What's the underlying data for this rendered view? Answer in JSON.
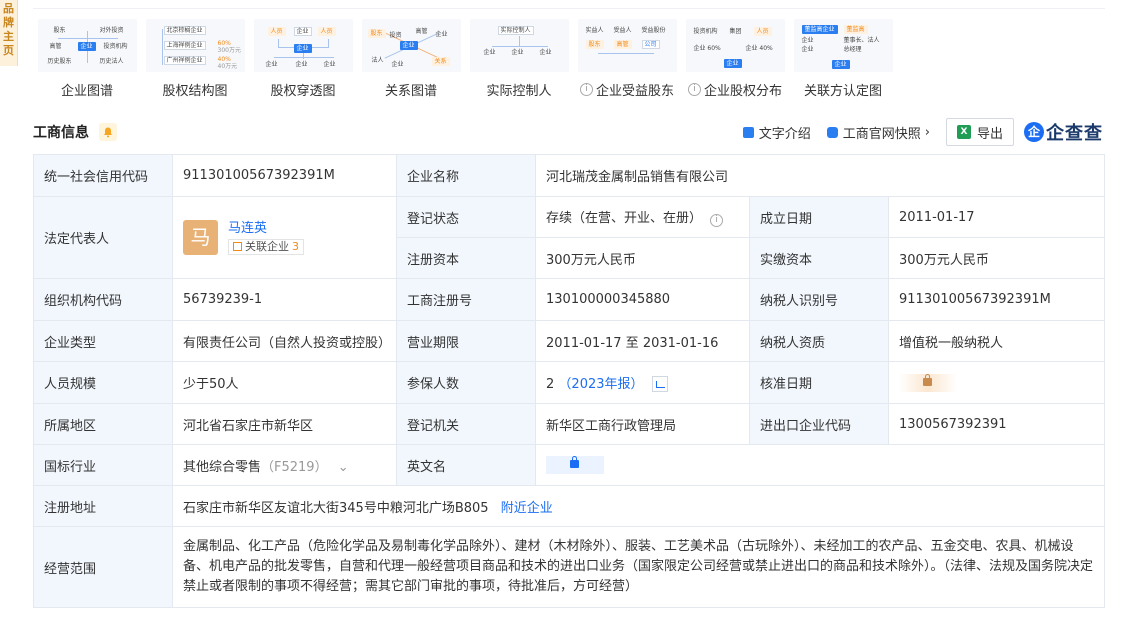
{
  "side_tab": "品牌主页",
  "thumbnails": [
    {
      "label": "企业图谱",
      "info": false
    },
    {
      "label": "股权结构图",
      "info": false
    },
    {
      "label": "股权穿透图",
      "info": false
    },
    {
      "label": "关系图谱",
      "info": false
    },
    {
      "label": "实际控制人",
      "info": false
    },
    {
      "label": "企业受益股东",
      "info": true
    },
    {
      "label": "企业股权分布",
      "info": true
    },
    {
      "label": "关联方认定图",
      "info": false
    }
  ],
  "mini": {
    "t1": [
      "股东",
      "对外投资",
      "高管",
      "企业",
      "投资机构",
      "历史股东",
      "历史法人"
    ],
    "t2": [
      "北京棕榈企业",
      "上海祥例企业",
      "广州祥例企业",
      "60%",
      "40%",
      "300万元",
      "40万元"
    ],
    "t3": [
      "人员",
      "企业",
      "人员",
      "企业",
      "企业",
      "企业",
      "企业"
    ],
    "t4": [
      "股东",
      "投资",
      "高管",
      "企业",
      "企业",
      "法人",
      "企业",
      "关系"
    ],
    "t5": [
      "实际控制人",
      "企业",
      "企业",
      "企业"
    ],
    "t6": [
      "实益人",
      "受益人",
      "受益股份",
      "股东",
      "高管",
      "公司"
    ],
    "t7": [
      "投资机构",
      "集团",
      "人员",
      "企业 60%",
      "企业 40%",
      "企业"
    ],
    "t8": [
      "董监高企业",
      "企业",
      "企业",
      "董监高",
      "董事长、法人",
      "总经理",
      "企业"
    ]
  },
  "header": {
    "title": "工商信息",
    "text_intro": "文字介绍",
    "snapshot": "工商官网快照",
    "export": "导出",
    "brand": "企查查",
    "brand_letter": "企"
  },
  "table": {
    "credit_code_label": "统一社会信用代码",
    "credit_code": "91130100567392391M",
    "company_name_label": "企业名称",
    "company_name": "河北瑞茂金属制品销售有限公司",
    "legal_rep_label": "法定代表人",
    "legal_rep_avatar": "马",
    "legal_rep_name": "马连英",
    "related_label": "关联企业",
    "related_count": "3",
    "reg_status_label": "登记状态",
    "reg_status": "存续（在营、开业、在册）",
    "found_date_label": "成立日期",
    "found_date": "2011-01-17",
    "reg_capital_label": "注册资本",
    "reg_capital": "300万元人民币",
    "paid_capital_label": "实缴资本",
    "paid_capital": "300万元人民币",
    "org_code_label": "组织机构代码",
    "org_code": "56739239-1",
    "biz_reg_no_label": "工商注册号",
    "biz_reg_no": "130100000345880",
    "taxpayer_id_label": "纳税人识别号",
    "taxpayer_id": "91130100567392391M",
    "company_type_label": "企业类型",
    "company_type": "有限责任公司（自然人投资或控股）",
    "biz_term_label": "营业期限",
    "biz_term": "2011-01-17 至 2031-01-16",
    "taxpayer_qual_label": "纳税人资质",
    "taxpayer_qual": "增值税一般纳税人",
    "staff_size_label": "人员规模",
    "staff_size": "少于50人",
    "insured_label": "参保人数",
    "insured": "2",
    "insured_year": "（2023年报）",
    "approve_date_label": "核准日期",
    "region_label": "所属地区",
    "region": "河北省石家庄市新华区",
    "reg_authority_label": "登记机关",
    "reg_authority": "新华区工商行政管理局",
    "ie_code_label": "进出口企业代码",
    "ie_code": "1300567392391",
    "industry_label": "国标行业",
    "industry": "其他综合零售",
    "industry_code": "（F5219）",
    "english_name_label": "英文名",
    "address_label": "注册地址",
    "address": "石家庄市新华区友谊北大街345号中粮河北广场B805",
    "nearby": "附近企业",
    "scope_label": "经营范围",
    "scope": "金属制品、化工产品（危险化学品及易制毒化学品除外）、建材（木材除外）、服装、工艺美术品（古玩除外）、未经加工的农产品、五金交电、农具、机械设备、机电产品的批发零售，自营和代理一般经营项目商品和技术的进出口业务（国家限定公司经营或禁止进出口的商品和技术除外）。（法律、法规及国务院决定禁止或者限制的事项不得经营；需其它部门审批的事项，待批准后，方可经营）"
  }
}
